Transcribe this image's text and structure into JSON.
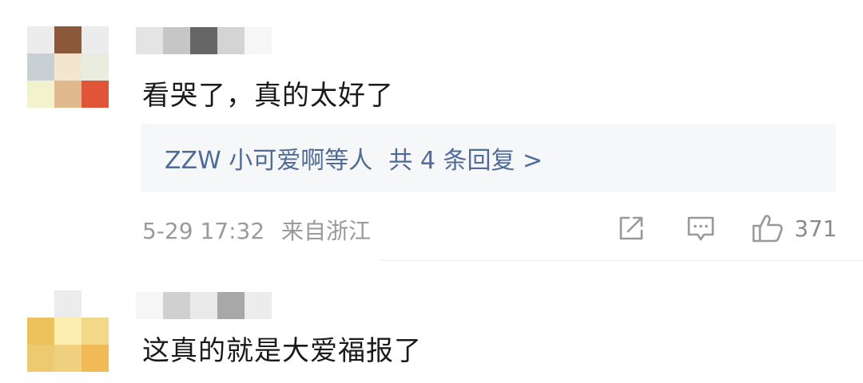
{
  "comments": [
    {
      "avatar_colors": [
        "#ececec",
        "#8a5a3a",
        "#ececec",
        "#c9d0d4",
        "#f3e6cf",
        "#e9ecdf",
        "#f2f2cc",
        "#e1b98f",
        "#e05438"
      ],
      "username_colors": [
        "#e4e4e4",
        "#c6c6c6",
        "#666666",
        "#d4d4d4",
        "#f6f6f6"
      ],
      "text": "看哭了，真的太好了",
      "replies": {
        "users": "ZZW 小可爱啊等人",
        "count": "共 4 条回复 >"
      },
      "meta": {
        "time": "5-29 17:32",
        "location": "来自浙江"
      },
      "likes": "371",
      "actions": {
        "share": "share-icon",
        "reply": "comment-icon",
        "like": "thumbs-up-icon"
      }
    },
    {
      "avatar_colors": [
        "#ffffff",
        "#ececec",
        "#ffffff",
        "#edc25c",
        "#fbeeb0",
        "#f2d889",
        "#edc96f",
        "#f0d07e",
        "#f0bb56"
      ],
      "username_colors": [
        "#f6f6f6",
        "#d0d0d0",
        "#e9e9e9",
        "#a8a8a8",
        "#ececec"
      ],
      "text": "这真的就是大爱福报了"
    }
  ],
  "colors": {
    "link": "#4f6b96",
    "meta": "#9a9a9a",
    "text": "#1a1a1a",
    "reply_bg": "#f6f7f9"
  }
}
